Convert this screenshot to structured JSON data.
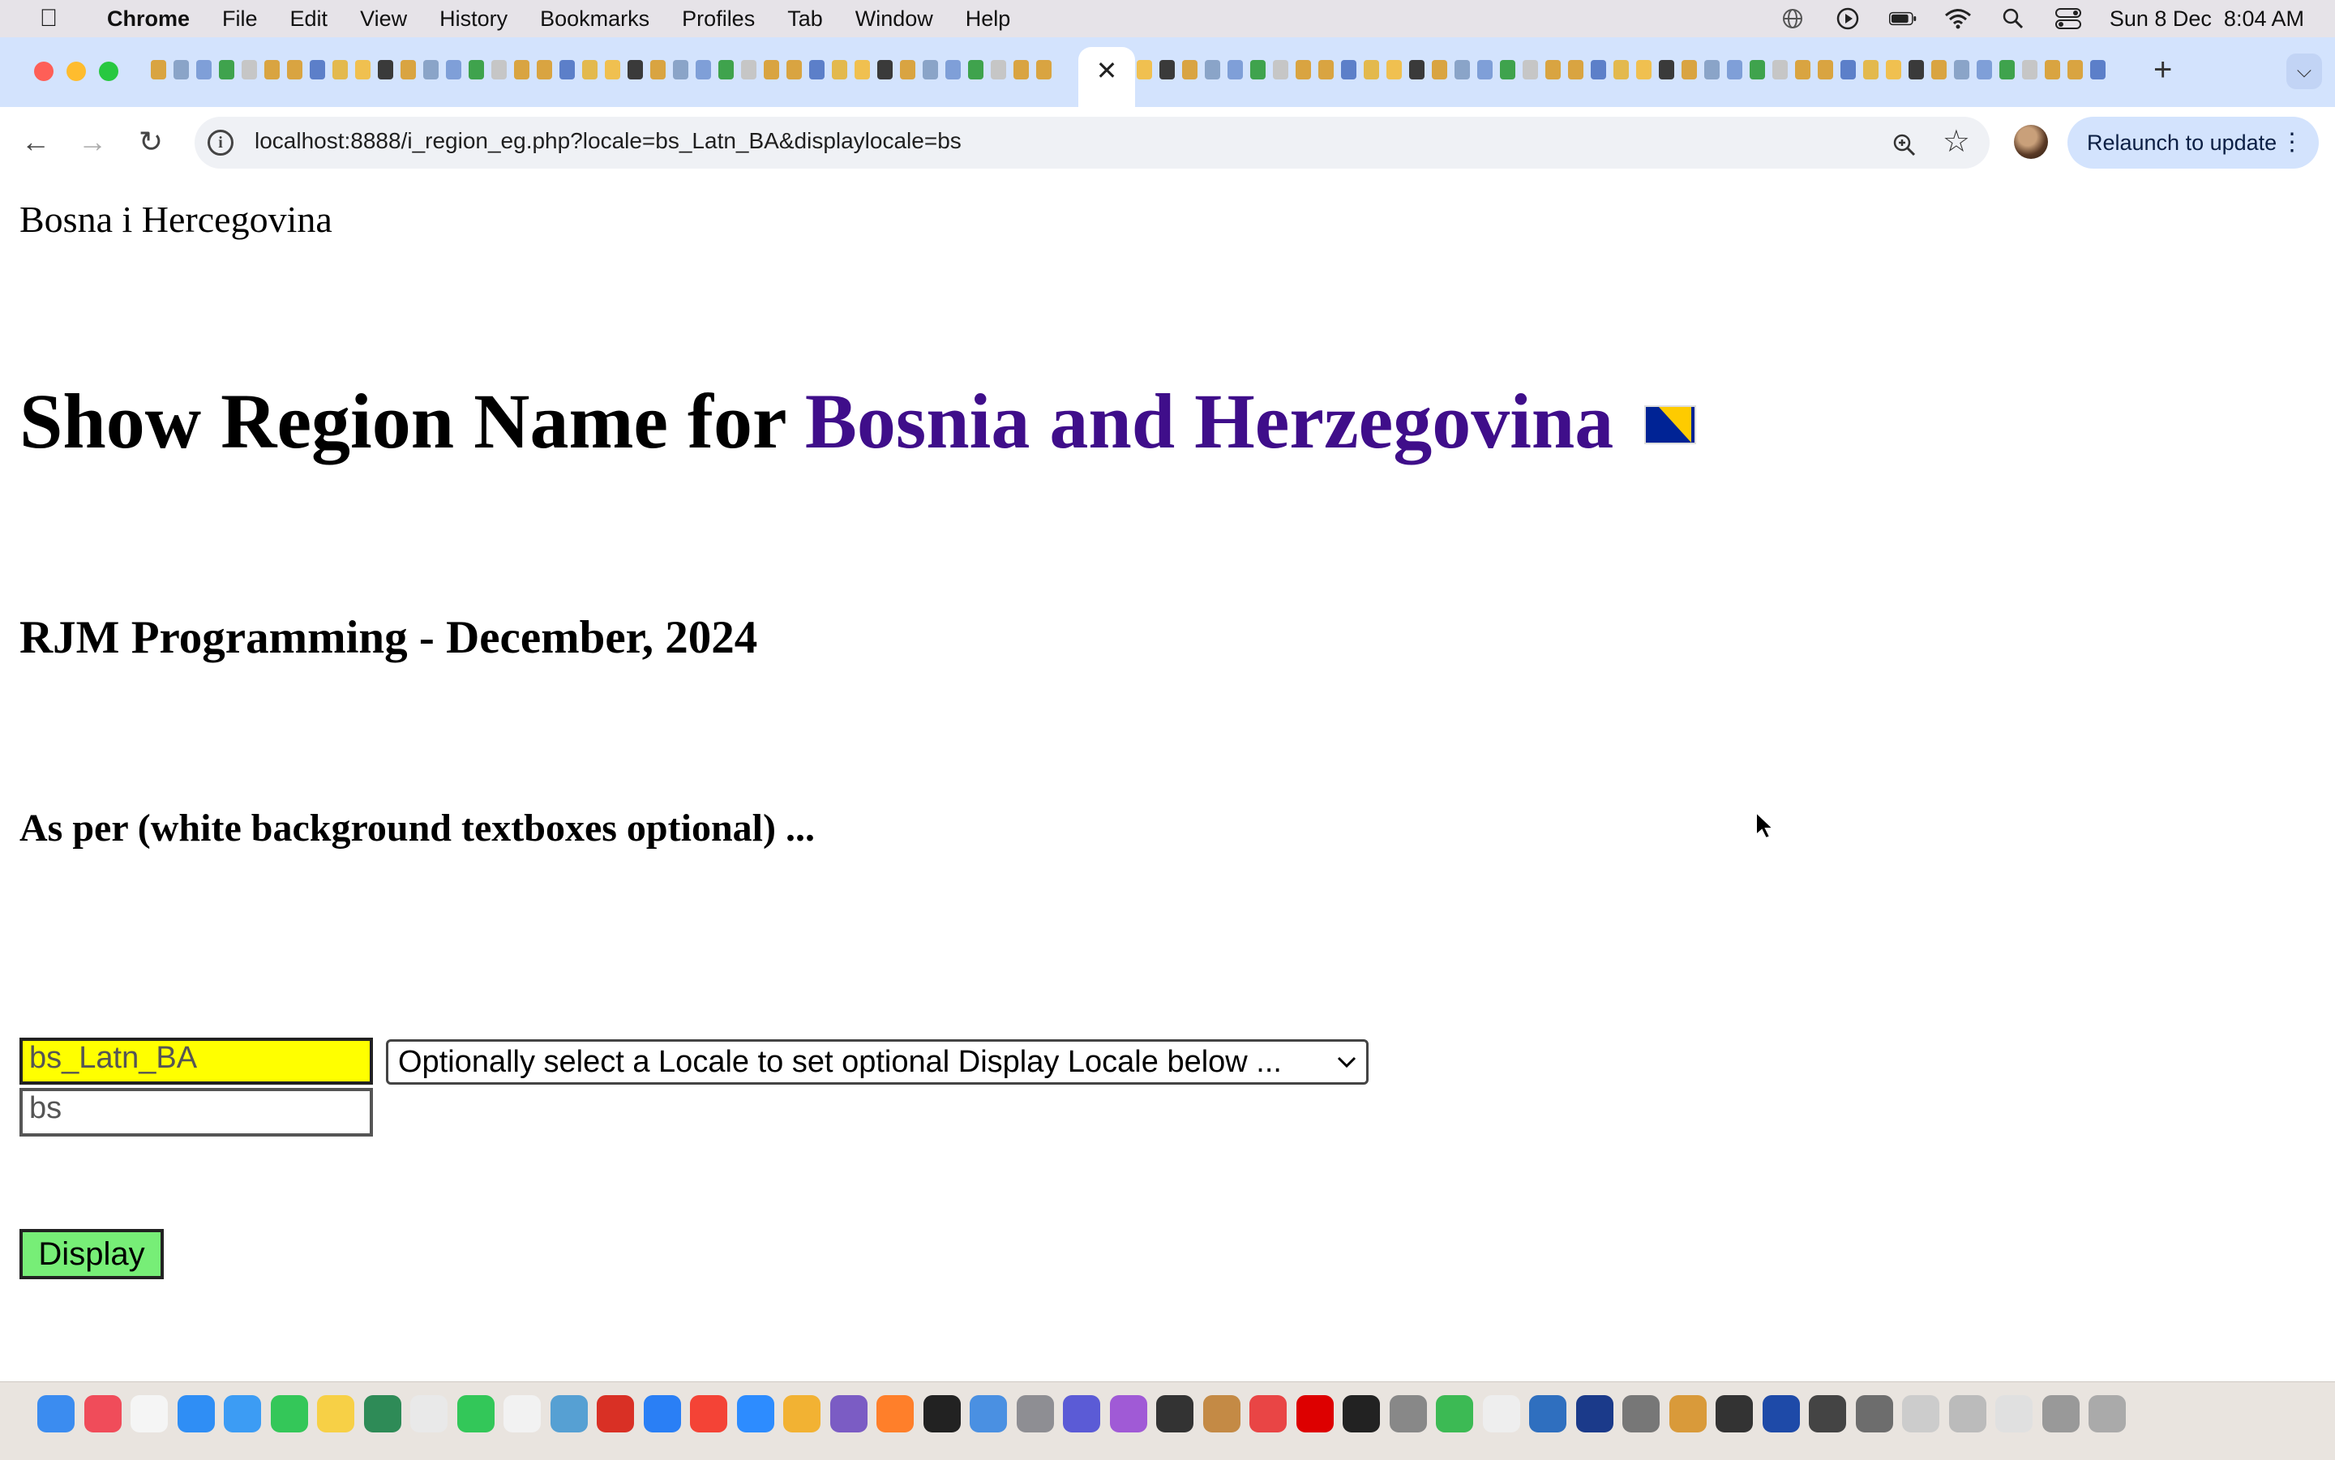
{
  "menubar": {
    "app_name": "Chrome",
    "items": [
      "File",
      "Edit",
      "View",
      "History",
      "Bookmarks",
      "Profiles",
      "Tab",
      "Window",
      "Help"
    ],
    "clock": "Sun 8 Dec  8:04 AM"
  },
  "toolbar": {
    "url": "localhost:8888/i_region_eg.php?locale=bs_Latn_BA&displaylocale=bs",
    "relaunch_label": "Relaunch to update"
  },
  "page": {
    "region_name": "Bosna i Hercegovina",
    "heading_prefix": "Show Region Name for ",
    "heading_country": "Bosnia and Herzegovina",
    "subheading": "RJM Programming - December, 2024",
    "subheading2": "As per (white background textboxes optional) ...",
    "locale_value": "bs_Latn_BA",
    "display_locale_value": "bs",
    "locale_select_label": "Optionally select a Locale to set optional Display Locale below ...",
    "display_button_label": "Display"
  },
  "colors": {
    "country_link": "#3f0e8a",
    "locale_input_bg": "#ffff00",
    "display_button_bg": "#77ee77",
    "tabstrip_bg": "#d3e3fd"
  }
}
